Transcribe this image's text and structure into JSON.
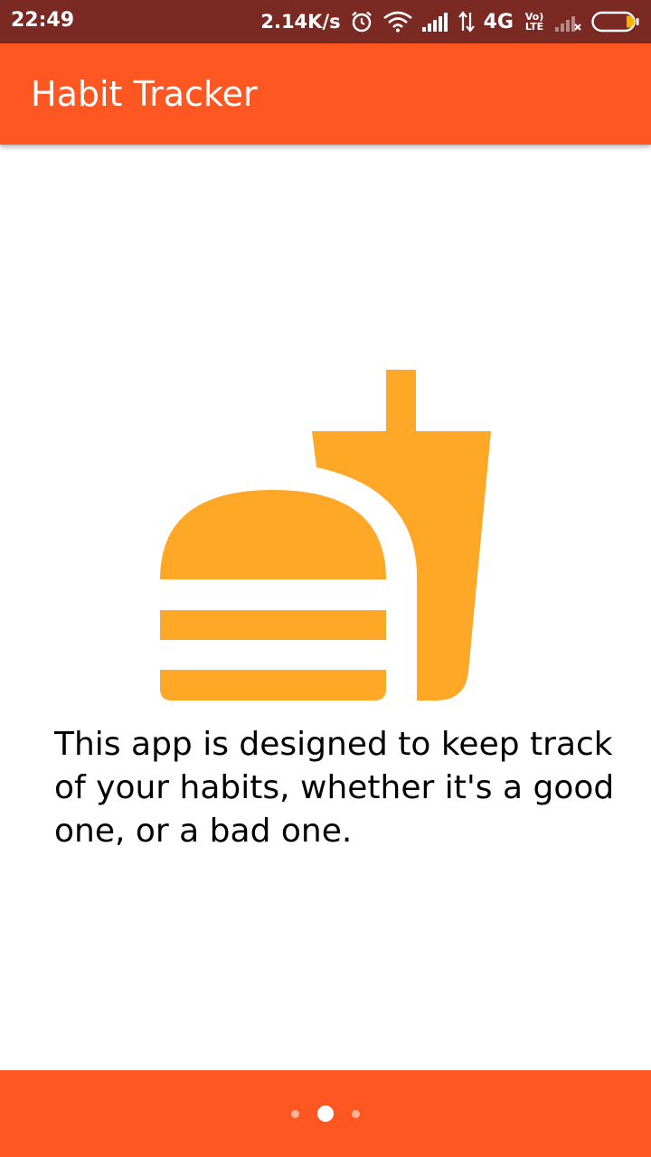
{
  "status_bar": {
    "time": "22:49",
    "network_speed": "2.14K/s",
    "network_type": "4G",
    "volte_line1": "Vo)",
    "volte_line2": "LTE",
    "icons": [
      "alarm-icon",
      "wifi-icon",
      "signal-icon",
      "data-arrows-icon",
      "volte-icon",
      "signal-weak-icon",
      "battery-icon"
    ],
    "battery_level": 0.15
  },
  "app_bar": {
    "title": "Habit Tracker"
  },
  "onboarding": {
    "illustration": "fastfood-icon",
    "illustration_color": "#ffa726",
    "description": "This app is designed to keep track of your habits, whether it's a good one, or a bad one.",
    "page_indicator": {
      "total": 3,
      "active": 2
    }
  },
  "colors": {
    "primary": "#ff5722",
    "status_bar": "#7a2a22",
    "accent_illustration": "#ffa726",
    "battery_fill": "#ffb300"
  }
}
